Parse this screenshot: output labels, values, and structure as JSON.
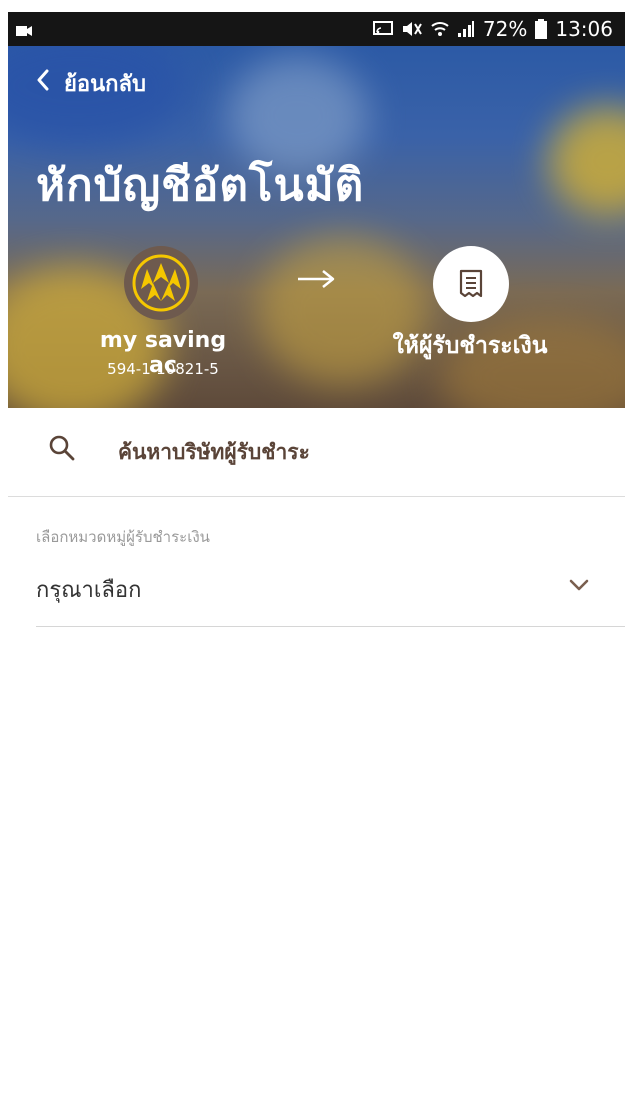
{
  "status_bar": {
    "battery_percent": "72%",
    "time": "13:06"
  },
  "header": {
    "back_label": "ย้อนกลับ",
    "title": "หักบัญชีอัตโนมัติ"
  },
  "source_account": {
    "name": "my saving ac",
    "number": "594-1-10821-5"
  },
  "destination": {
    "label": "ให้ผู้รับชำระเงิน"
  },
  "search": {
    "label": "ค้นหาบริษัทผู้รับชำระ"
  },
  "category": {
    "label": "เลือกหมวดหมู่ผู้รับชำระเงิน",
    "value": "กรุณาเลือก"
  },
  "colors": {
    "accent_brown": "#5a4438",
    "logo_yellow": "#f5c700",
    "logo_bg": "#6e5a4e"
  }
}
